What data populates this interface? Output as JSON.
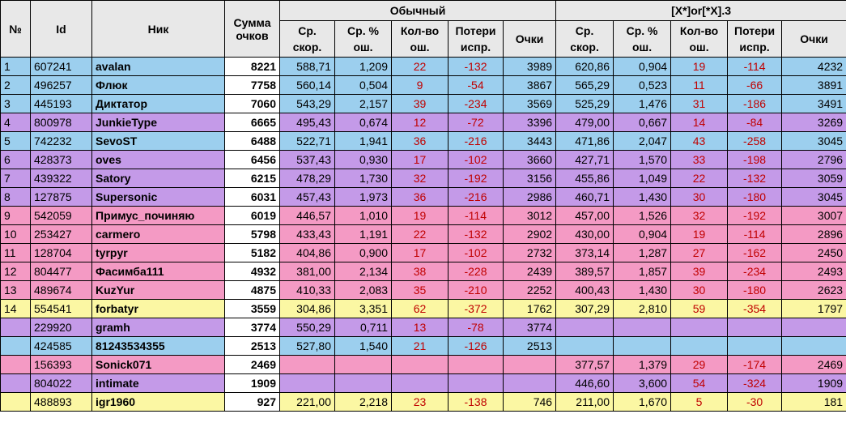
{
  "headers": {
    "num": "№",
    "id": "Id",
    "nick": "Ник",
    "sum_line1": "Сумма",
    "sum_line2": "очков",
    "group1": "Обычный",
    "group2": "[X*]or[*X].3",
    "speed_l1": "Ср.",
    "speed_l2": "скор.",
    "err_l1": "Ср. %",
    "err_l2": "ош.",
    "cnt_l1": "Кол-во",
    "cnt_l2": "ош.",
    "loss_l1": "Потери",
    "loss_l2": "испр.",
    "pts": "Очки"
  },
  "colors": {
    "blue": "#9ccfee",
    "violet": "#c49ae8",
    "pink": "#f49ac4",
    "yellow": "#fbf7a3",
    "header": "#e8e8e8",
    "red_text": "#c00000"
  },
  "rows": [
    {
      "num": "1",
      "id": "607241",
      "nick": "avalan",
      "sum": "8221",
      "c": "blue",
      "g1": [
        "588,71",
        "1,209",
        "22",
        "-132",
        "3989"
      ],
      "g2": [
        "620,86",
        "0,904",
        "19",
        "-114",
        "4232"
      ]
    },
    {
      "num": "2",
      "id": "496257",
      "nick": "Флюк",
      "sum": "7758",
      "c": "blue",
      "g1": [
        "560,14",
        "0,504",
        "9",
        "-54",
        "3867"
      ],
      "g2": [
        "565,29",
        "0,523",
        "11",
        "-66",
        "3891"
      ]
    },
    {
      "num": "3",
      "id": "445193",
      "nick": "Диктатор",
      "sum": "7060",
      "c": "blue",
      "g1": [
        "543,29",
        "2,157",
        "39",
        "-234",
        "3569"
      ],
      "g2": [
        "525,29",
        "1,476",
        "31",
        "-186",
        "3491"
      ]
    },
    {
      "num": "4",
      "id": "800978",
      "nick": "JunkieType",
      "sum": "6665",
      "c": "violet",
      "g1": [
        "495,43",
        "0,674",
        "12",
        "-72",
        "3396"
      ],
      "g2": [
        "479,00",
        "0,667",
        "14",
        "-84",
        "3269"
      ]
    },
    {
      "num": "5",
      "id": "742232",
      "nick": "SevoST",
      "sum": "6488",
      "c": "blue",
      "g1": [
        "522,71",
        "1,941",
        "36",
        "-216",
        "3443"
      ],
      "g2": [
        "471,86",
        "2,047",
        "43",
        "-258",
        "3045"
      ]
    },
    {
      "num": "6",
      "id": "428373",
      "nick": "oves",
      "sum": "6456",
      "c": "violet",
      "g1": [
        "537,43",
        "0,930",
        "17",
        "-102",
        "3660"
      ],
      "g2": [
        "427,71",
        "1,570",
        "33",
        "-198",
        "2796"
      ]
    },
    {
      "num": "7",
      "id": "439322",
      "nick": "Satory",
      "sum": "6215",
      "c": "violet",
      "g1": [
        "478,29",
        "1,730",
        "32",
        "-192",
        "3156"
      ],
      "g2": [
        "455,86",
        "1,049",
        "22",
        "-132",
        "3059"
      ]
    },
    {
      "num": "8",
      "id": "127875",
      "nick": "Supersonic",
      "sum": "6031",
      "c": "violet",
      "g1": [
        "457,43",
        "1,973",
        "36",
        "-216",
        "2986"
      ],
      "g2": [
        "460,71",
        "1,430",
        "30",
        "-180",
        "3045"
      ]
    },
    {
      "num": "9",
      "id": "542059",
      "nick": "Примус_починяю",
      "sum": "6019",
      "c": "pink",
      "g1": [
        "446,57",
        "1,010",
        "19",
        "-114",
        "3012"
      ],
      "g2": [
        "457,00",
        "1,526",
        "32",
        "-192",
        "3007"
      ]
    },
    {
      "num": "10",
      "id": "253427",
      "nick": "carmero",
      "sum": "5798",
      "c": "pink",
      "g1": [
        "433,43",
        "1,191",
        "22",
        "-132",
        "2902"
      ],
      "g2": [
        "430,00",
        "0,904",
        "19",
        "-114",
        "2896"
      ]
    },
    {
      "num": "11",
      "id": "128704",
      "nick": "tyrpyr",
      "sum": "5182",
      "c": "pink",
      "g1": [
        "404,86",
        "0,900",
        "17",
        "-102",
        "2732"
      ],
      "g2": [
        "373,14",
        "1,287",
        "27",
        "-162",
        "2450"
      ]
    },
    {
      "num": "12",
      "id": "804477",
      "nick": "Фасимба111",
      "sum": "4932",
      "c": "pink",
      "g1": [
        "381,00",
        "2,134",
        "38",
        "-228",
        "2439"
      ],
      "g2": [
        "389,57",
        "1,857",
        "39",
        "-234",
        "2493"
      ]
    },
    {
      "num": "13",
      "id": "489674",
      "nick": "KuzYur",
      "sum": "4875",
      "c": "pink",
      "g1": [
        "410,33",
        "2,083",
        "35",
        "-210",
        "2252"
      ],
      "g2": [
        "400,43",
        "1,430",
        "30",
        "-180",
        "2623"
      ]
    },
    {
      "num": "14",
      "id": "554541",
      "nick": "forbatyr",
      "sum": "3559",
      "c": "yellow",
      "g1": [
        "304,86",
        "3,351",
        "62",
        "-372",
        "1762"
      ],
      "g2": [
        "307,29",
        "2,810",
        "59",
        "-354",
        "1797"
      ]
    },
    {
      "num": "",
      "id": "229920",
      "nick": "gramh",
      "sum": "3774",
      "c": "violet",
      "g1": [
        "550,29",
        "0,711",
        "13",
        "-78",
        "3774"
      ],
      "g2": [
        "",
        "",
        "",
        "",
        ""
      ]
    },
    {
      "num": "",
      "id": "424585",
      "nick": "81243534355",
      "sum": "2513",
      "c": "blue",
      "g1": [
        "527,80",
        "1,540",
        "21",
        "-126",
        "2513"
      ],
      "g2": [
        "",
        "",
        "",
        "",
        ""
      ]
    },
    {
      "num": "",
      "id": "156393",
      "nick": "Sonick071",
      "sum": "2469",
      "c": "pink",
      "g1": [
        "",
        "",
        "",
        "",
        ""
      ],
      "g2": [
        "377,57",
        "1,379",
        "29",
        "-174",
        "2469"
      ]
    },
    {
      "num": "",
      "id": "804022",
      "nick": "intimate",
      "sum": "1909",
      "c": "violet",
      "g1": [
        "",
        "",
        "",
        "",
        ""
      ],
      "g2": [
        "446,60",
        "3,600",
        "54",
        "-324",
        "1909"
      ]
    },
    {
      "num": "",
      "id": "488893",
      "nick": "igr1960",
      "sum": "927",
      "c": "yellow",
      "g1": [
        "221,00",
        "2,218",
        "23",
        "-138",
        "746"
      ],
      "g2": [
        "211,00",
        "1,670",
        "5",
        "-30",
        "181"
      ]
    }
  ]
}
